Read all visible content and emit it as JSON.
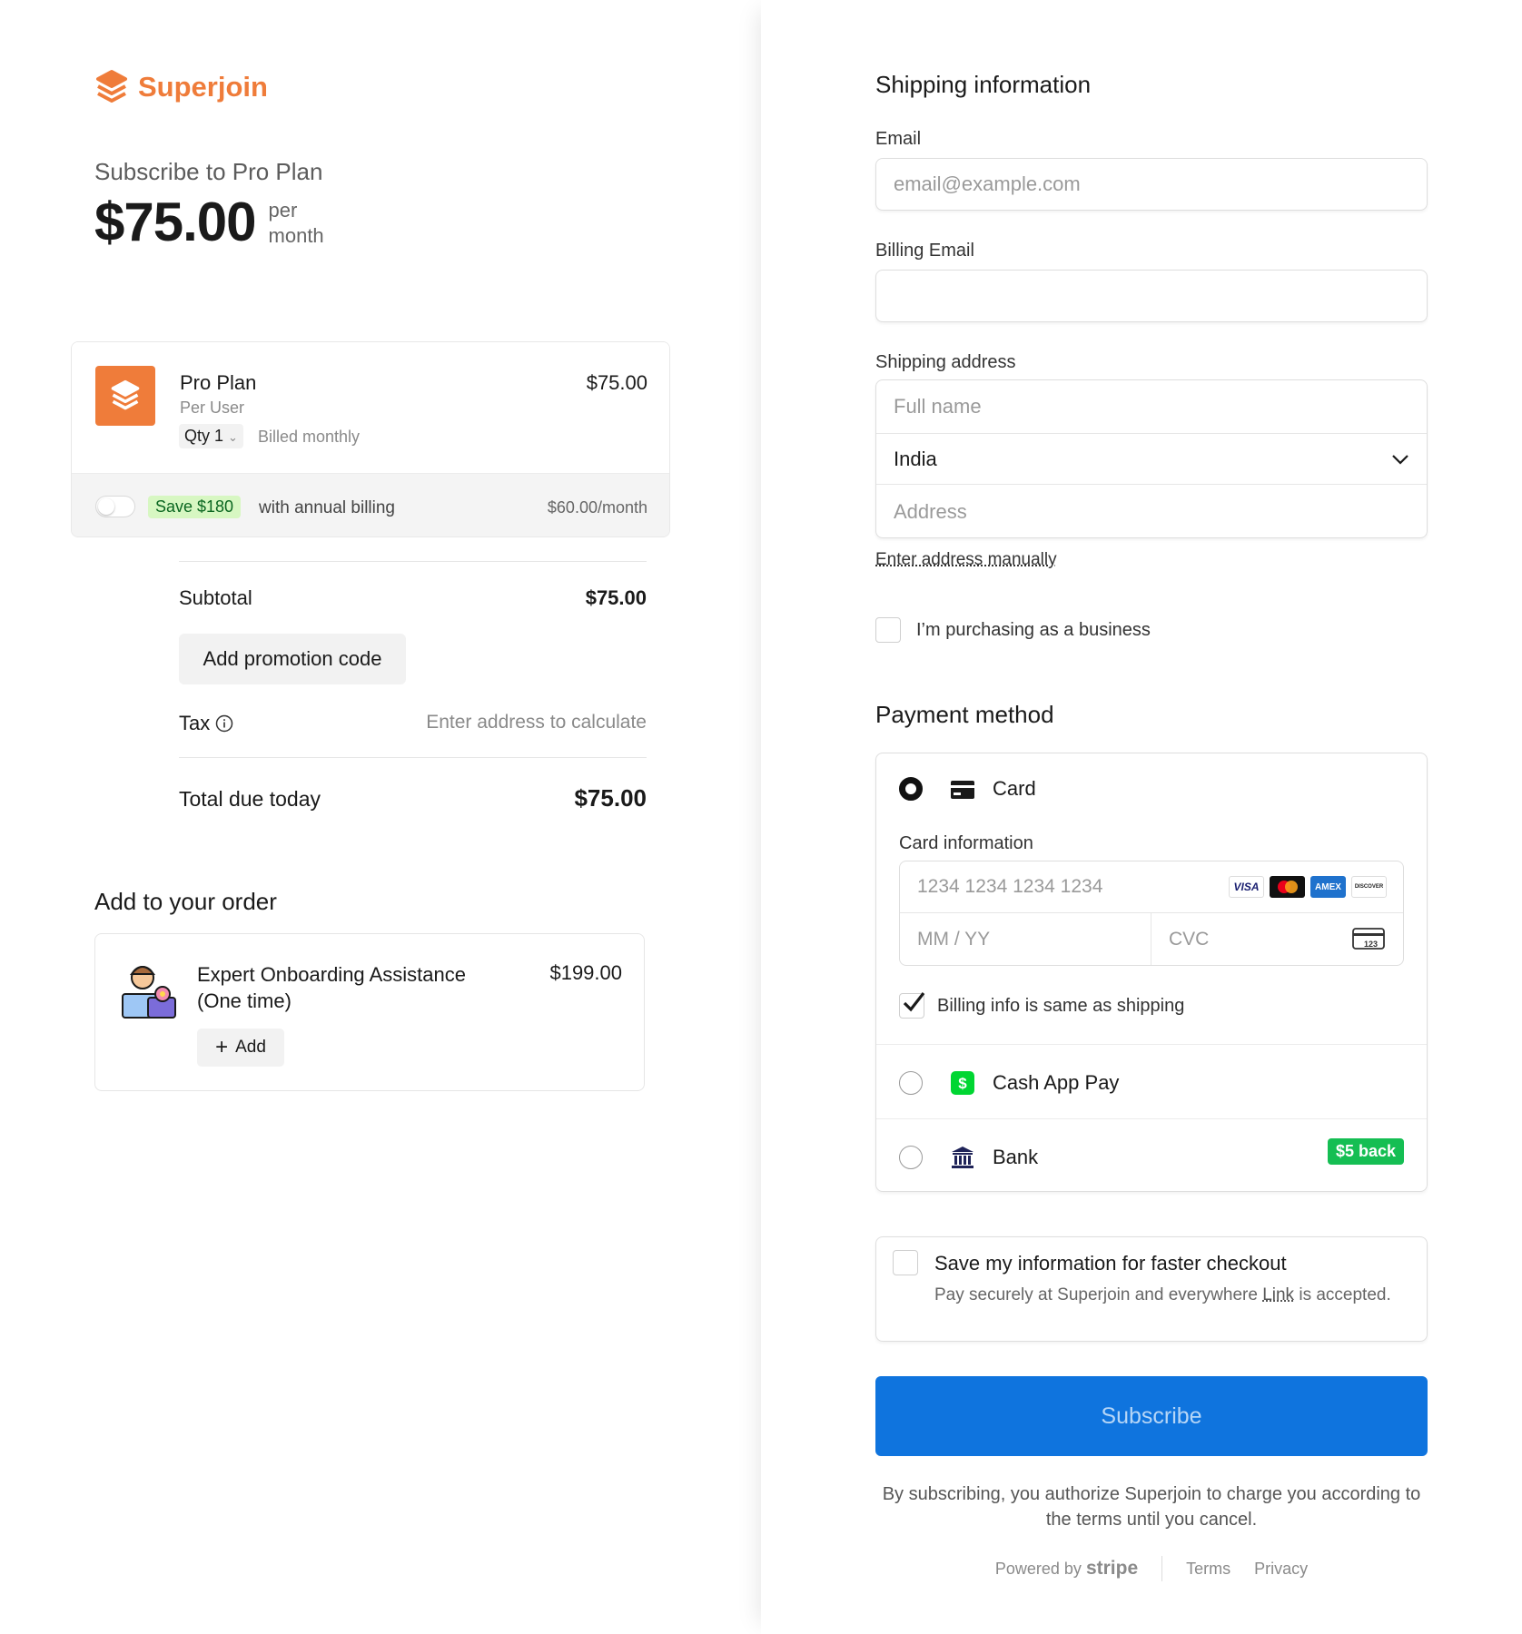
{
  "brand": {
    "name": "Superjoin",
    "accent": "#ef7c3a"
  },
  "summary": {
    "subscribe_title": "Subscribe to Pro Plan",
    "price": "$75.00",
    "period": "per month"
  },
  "plan": {
    "name": "Pro Plan",
    "sub": "Per User",
    "qty": "Qty 1",
    "billed": "Billed monthly",
    "price": "$75.00",
    "save_badge": "Save $180",
    "annual_text": "with annual billing",
    "annual_price": "$60.00/month"
  },
  "totals": {
    "subtotal_label": "Subtotal",
    "subtotal_value": "$75.00",
    "promo_label": "Add promotion code",
    "tax_label": "Tax",
    "tax_value": "Enter address to calculate",
    "total_label": "Total due today",
    "total_value": "$75.00"
  },
  "addons": {
    "title": "Add to your order",
    "item_name": "Expert Onboarding Assistance (One time)",
    "item_price": "$199.00",
    "add_label": "Add"
  },
  "shipping": {
    "title": "Shipping information",
    "email_label": "Email",
    "email_placeholder": "email@example.com",
    "billing_email_label": "Billing Email",
    "billing_email_value": "",
    "address_label": "Shipping address",
    "full_name_placeholder": "Full name",
    "country": "India",
    "address_placeholder": "Address",
    "enter_manual": "Enter address manually",
    "business_label": "I’m purchasing as a business"
  },
  "payment": {
    "title": "Payment method",
    "card_label": "Card",
    "card_info_label": "Card information",
    "card_number_placeholder": "1234 1234 1234 1234",
    "expiry_placeholder": "MM / YY",
    "cvc_placeholder": "CVC",
    "cvc_hint": "123",
    "brands": [
      "VISA",
      "MC",
      "AMEX",
      "DISCOVER"
    ],
    "billing_same": "Billing info is same as shipping",
    "cashapp_label": "Cash App Pay",
    "bank_label": "Bank",
    "bank_badge": "$5 back"
  },
  "save_info": {
    "title": "Save my information for faster checkout",
    "desc_prefix": "Pay securely at Superjoin and everywhere",
    "link": "Link",
    "desc_suffix": "is accepted."
  },
  "submit": {
    "label": "Subscribe",
    "legal": "By subscribing, you authorize Superjoin to charge you according to the terms until you cancel."
  },
  "footer": {
    "powered_by": "Powered by",
    "stripe": "stripe",
    "terms": "Terms",
    "privacy": "Privacy"
  },
  "colors": {
    "primary": "#0f74de",
    "success": "#15be53",
    "save_green_bg": "#d7f7c2"
  }
}
